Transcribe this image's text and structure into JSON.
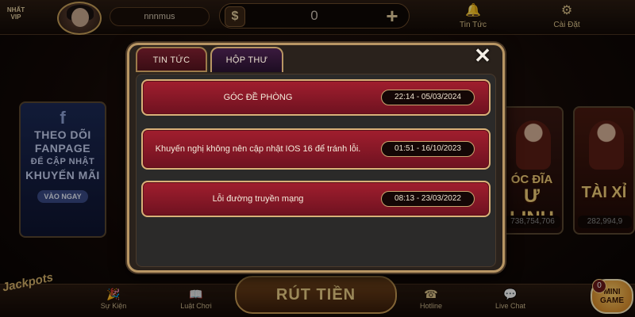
{
  "header": {
    "logo_text": "NHẤT VIP",
    "username": "nnnmus",
    "balance": "0",
    "currency_symbol": "$",
    "news_label": "Tin Tức",
    "settings_label": "Cài Đặt"
  },
  "background": {
    "fanpage_lines": [
      "THEO DÕI",
      "FANPAGE",
      "ĐỂ CẬP NHẬT",
      "KHUYẾN MÃI"
    ],
    "fanpage_button": "VÀO NGAY",
    "card1_title_top": "ÓC ĐĨA",
    "card1_title_bottom": "Ư LINH",
    "card1_jackpot": "738,754,706",
    "card2_title": "TÀI XỈ",
    "card2_jackpot": "282,994,9"
  },
  "modal": {
    "tabs": [
      {
        "label": "TIN TỨC",
        "active": false
      },
      {
        "label": "HỘP THƯ",
        "active": true
      }
    ],
    "close_symbol": "✕",
    "messages": [
      {
        "title": "GÓC ĐỀ PHÒNG",
        "datetime": "22:14 - 05/03/2024"
      },
      {
        "title": "Khuyến nghị không nên cập nhật IOS 16 để tránh lỗi.",
        "datetime": "01:51 - 16/10/2023"
      },
      {
        "title": "Lỗi đường truyền mạng",
        "datetime": "08:13 - 23/03/2022"
      }
    ]
  },
  "footer": {
    "jackpot_logo": "Jackpots",
    "events_label": "Sự Kiện",
    "rules_label": "Luật Chơi",
    "withdraw_label": "RÚT TIỀN",
    "hotline_label": "Hotline",
    "livechat_label": "Live Chat",
    "minigame_line1": "MINI",
    "minigame_line2": "GAME",
    "minigame_badge": "0"
  },
  "colors": {
    "accent_gold": "#b89664",
    "message_red": "#a11e2e",
    "active_tab_purple": "#3a1a3e"
  },
  "icons": {
    "dollar": "dollar-icon",
    "plus": "plus-icon",
    "news": "bell-icon",
    "settings": "gear-icon",
    "close": "close-icon",
    "events": "party-popper-icon",
    "rules": "book-icon",
    "hotline": "phone-icon",
    "livechat": "chat-icon"
  }
}
